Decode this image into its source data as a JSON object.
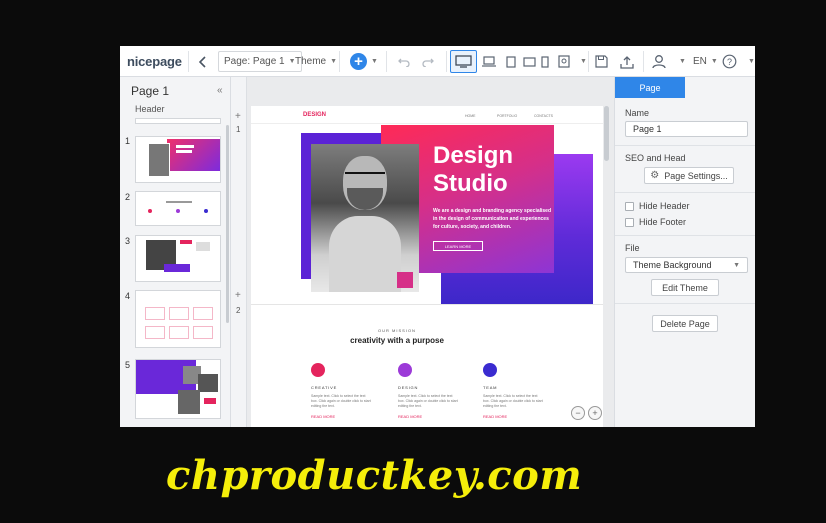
{
  "toolbar": {
    "logo": "nicepage",
    "page_select": "Page: Page 1",
    "theme": "Theme",
    "language": "EN"
  },
  "left_panel": {
    "title": "Page 1",
    "header_label": "Header",
    "page_numbers": [
      "1",
      "2",
      "3",
      "4",
      "5"
    ]
  },
  "canvas": {
    "ruler_plus": "+",
    "section_numbers": [
      "1",
      "2"
    ],
    "site_logo": "DESIGN",
    "nav": [
      "HOME",
      "PORTFOLIO",
      "CONTACTS"
    ],
    "hero_title_line1": "Design",
    "hero_title_line2": "Studio",
    "hero_text": "We are a design and branding agency specialised in the design of communication and experiences for culture, society, and children.",
    "hero_button": "LEARN MORE",
    "section2_kicker": "OUR MISSION",
    "section2_title": "creativity with a purpose",
    "features": [
      {
        "title": "CREATIVE",
        "link": "READ MORE"
      },
      {
        "title": "DESIGN",
        "link": "READ MORE"
      },
      {
        "title": "TEAM",
        "link": "READ MORE"
      }
    ],
    "feature_text": "Sample text. Click to select the text box. Click again or double click to start editing the text."
  },
  "right_panel": {
    "tab": "Page",
    "name_label": "Name",
    "name_value": "Page 1",
    "seo_label": "SEO and Head",
    "page_settings": "Page Settings...",
    "hide_header": "Hide Header",
    "hide_footer": "Hide Footer",
    "file_label": "File",
    "theme_background": "Theme Background",
    "edit_theme": "Edit Theme",
    "delete_page": "Delete Page"
  },
  "watermark": "chproductkey.com",
  "colors": {
    "accent": "#2f86e8",
    "brand_pink": "#e4245d",
    "brand_purple": "#6a28d9"
  }
}
